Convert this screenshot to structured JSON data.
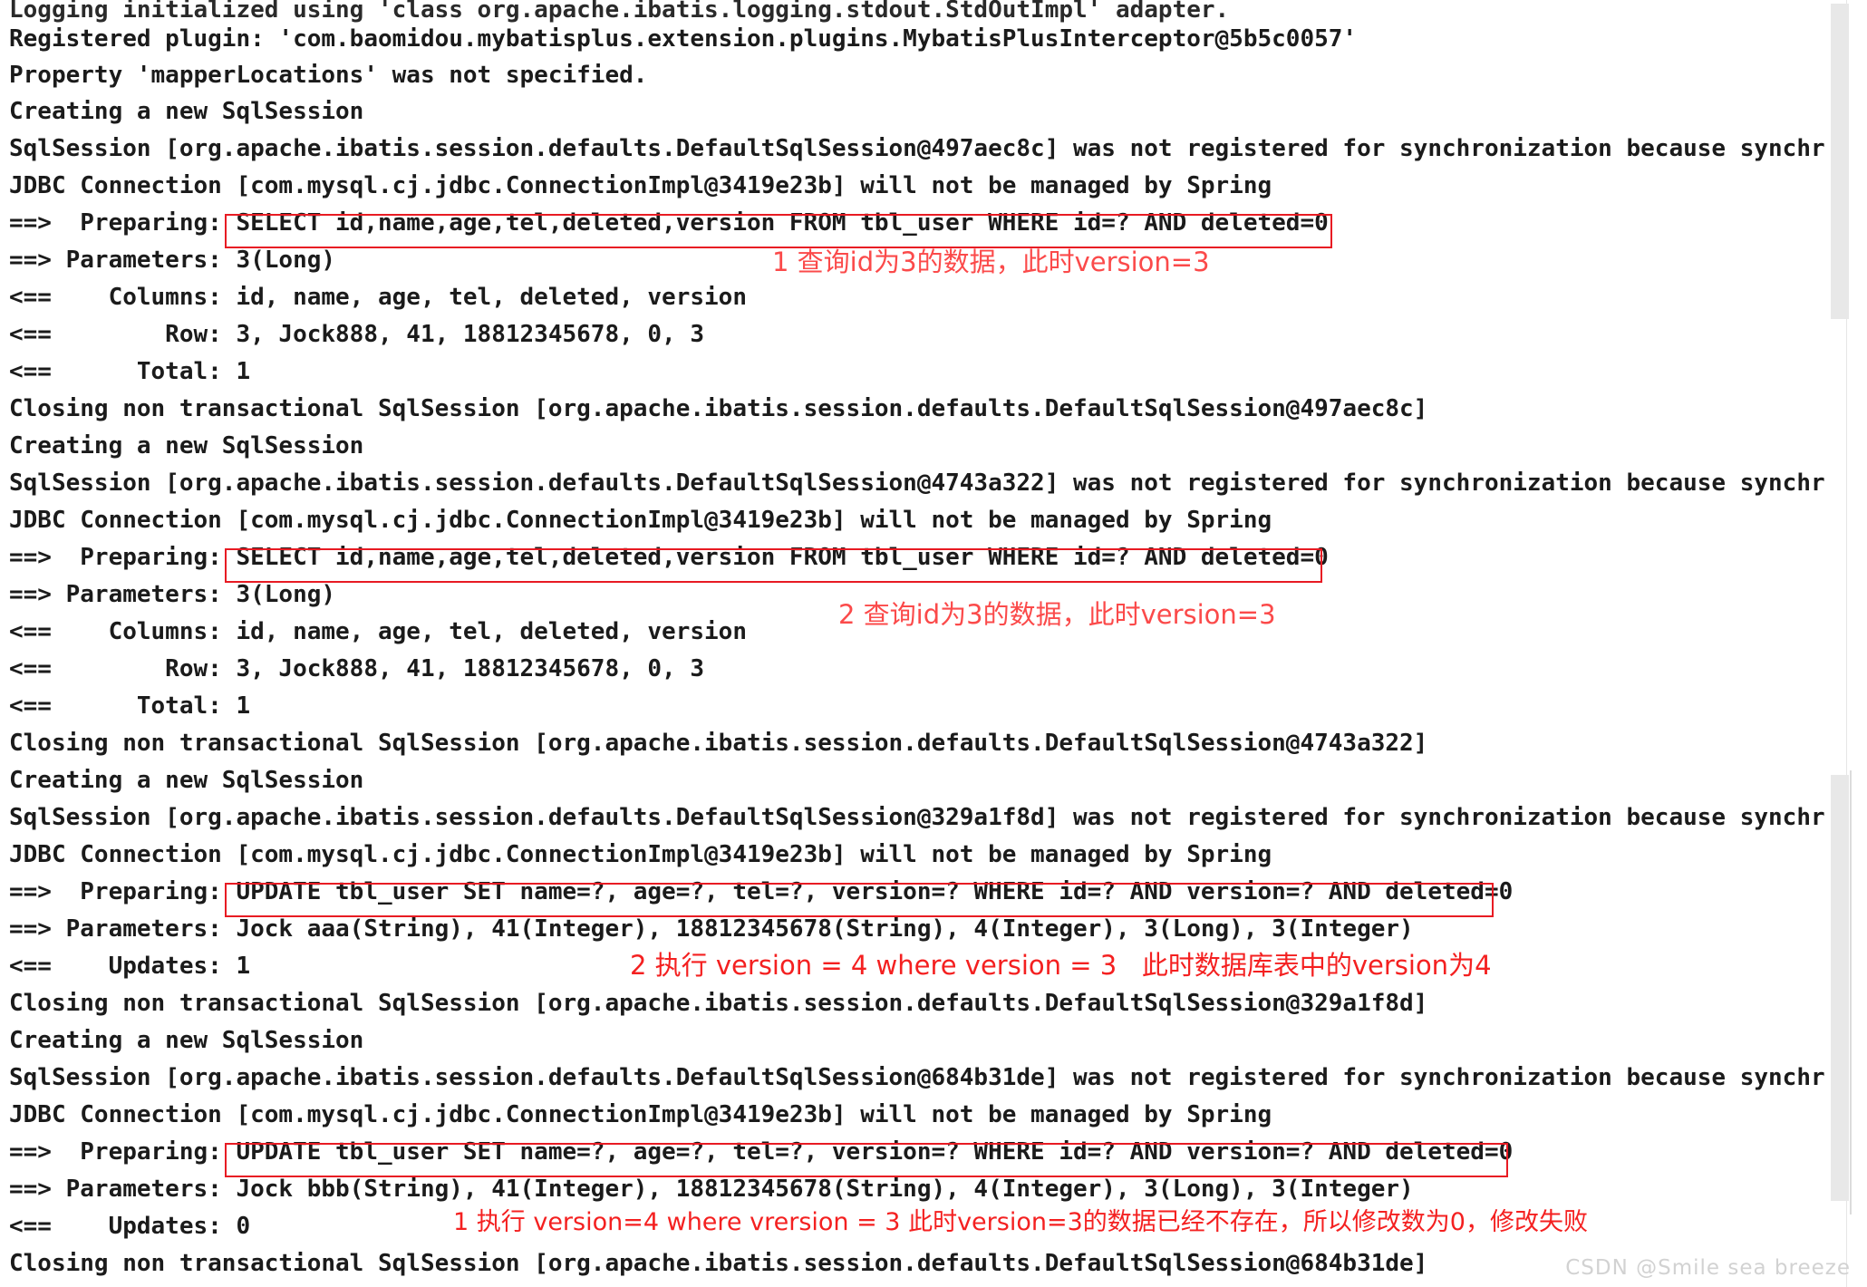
{
  "app": {
    "type": "console-log-output",
    "watermark": "CSDN @Smile sea breeze",
    "colors": {
      "background": "#ffffff",
      "log_text": "#1b1b1b",
      "highlight_border": "#e81b23",
      "annotation_red": "#fb2b2b",
      "scrollbar_thumb": "#e8e8e8",
      "watermark": "#d2d2d2"
    }
  },
  "log": {
    "lines": [
      "Logging initialized using 'class org.apache.ibatis.logging.stdout.StdOutImpl' adapter.",
      "Registered plugin: 'com.baomidou.mybatisplus.extension.plugins.MybatisPlusInterceptor@5b5c0057'",
      "Property 'mapperLocations' was not specified.",
      "Creating a new SqlSession",
      "SqlSession [org.apache.ibatis.session.defaults.DefaultSqlSession@497aec8c] was not registered for synchronization because synchr",
      "JDBC Connection [com.mysql.cj.jdbc.ConnectionImpl@3419e23b] will not be managed by Spring",
      "==>  Preparing: SELECT id,name,age,tel,deleted,version FROM tbl_user WHERE id=? AND deleted=0",
      "==> Parameters: 3(Long)",
      "<==    Columns: id, name, age, tel, deleted, version",
      "<==        Row: 3, Jock888, 41, 18812345678, 0, 3",
      "<==      Total: 1",
      "Closing non transactional SqlSession [org.apache.ibatis.session.defaults.DefaultSqlSession@497aec8c]",
      "Creating a new SqlSession",
      "SqlSession [org.apache.ibatis.session.defaults.DefaultSqlSession@4743a322] was not registered for synchronization because synchr",
      "JDBC Connection [com.mysql.cj.jdbc.ConnectionImpl@3419e23b] will not be managed by Spring",
      "==>  Preparing: SELECT id,name,age,tel,deleted,version FROM tbl_user WHERE id=? AND deleted=0",
      "==> Parameters: 3(Long)",
      "<==    Columns: id, name, age, tel, deleted, version",
      "<==        Row: 3, Jock888, 41, 18812345678, 0, 3",
      "<==      Total: 1",
      "Closing non transactional SqlSession [org.apache.ibatis.session.defaults.DefaultSqlSession@4743a322]",
      "Creating a new SqlSession",
      "SqlSession [org.apache.ibatis.session.defaults.DefaultSqlSession@329a1f8d] was not registered for synchronization because synchr",
      "JDBC Connection [com.mysql.cj.jdbc.ConnectionImpl@3419e23b] will not be managed by Spring",
      "==>  Preparing: UPDATE tbl_user SET name=?, age=?, tel=?, version=? WHERE id=? AND version=? AND deleted=0",
      "==> Parameters: Jock aaa(String), 41(Integer), 18812345678(String), 4(Integer), 3(Long), 3(Integer)",
      "<==    Updates: 1",
      "Closing non transactional SqlSession [org.apache.ibatis.session.defaults.DefaultSqlSession@329a1f8d]",
      "Creating a new SqlSession",
      "SqlSession [org.apache.ibatis.session.defaults.DefaultSqlSession@684b31de] was not registered for synchronization because synchr",
      "JDBC Connection [com.mysql.cj.jdbc.ConnectionImpl@3419e23b] will not be managed by Spring",
      "==>  Preparing: UPDATE tbl_user SET name=?, age=?, tel=?, version=? WHERE id=? AND version=? AND deleted=0",
      "==> Parameters: Jock bbb(String), 41(Integer), 18812345678(String), 4(Integer), 3(Long), 3(Integer)",
      "<==    Updates: 0",
      "Closing non transactional SqlSession [org.apache.ibatis.session.defaults.DefaultSqlSession@684b31de]"
    ]
  },
  "annotations": [
    {
      "id": "annotation-1",
      "text": "1 查询id为3的数据，此时version=3"
    },
    {
      "id": "annotation-2",
      "text": "2 查询id为3的数据，此时version=3"
    },
    {
      "id": "annotation-3",
      "text": "2 执行 version = 4 where version = 3   此时数据库表中的version为4"
    },
    {
      "id": "annotation-4",
      "text": "1 执行 version=4 where vrersion = 3 此时version=3的数据已经不存在，所以修改数为0，修改失败"
    }
  ],
  "highlights": [
    {
      "id": "sql-highlight-select-1",
      "sql": "SELECT id,name,age,tel,deleted,version FROM tbl_user WHERE id=? AND deleted=0"
    },
    {
      "id": "sql-highlight-select-2",
      "sql": "SELECT id,name,age,tel,deleted,version FROM tbl_user WHERE id=? AND deleted=0"
    },
    {
      "id": "sql-highlight-update-1",
      "sql": "UPDATE tbl_user SET name=?, age=?, tel=?, version=? WHERE id=? AND version=? AND deleted=0"
    },
    {
      "id": "sql-highlight-update-2",
      "sql": "UPDATE tbl_user SET name=?, age=?, tel=?, version=? WHERE id=? AND version=? AND deleted=0"
    }
  ]
}
